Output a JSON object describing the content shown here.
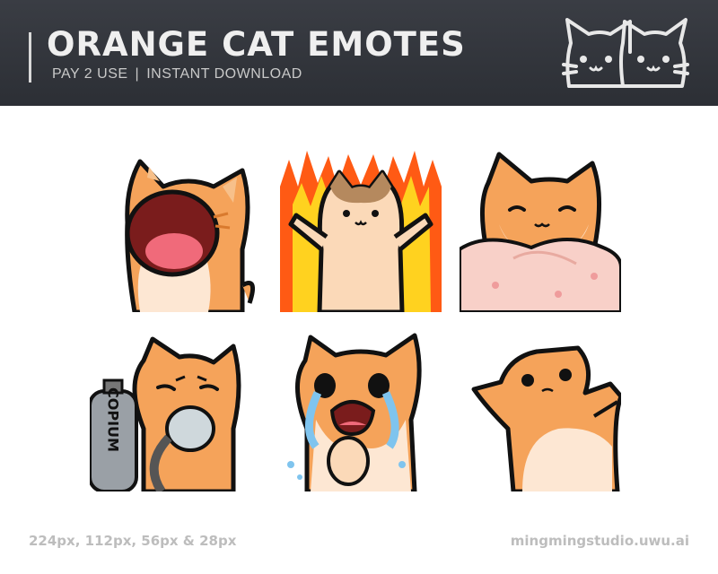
{
  "header": {
    "title": "ORANGE CAT EMOTES",
    "tagline_left": "PAY 2 USE",
    "tagline_sep": "|",
    "tagline_right": "INSTANT DOWNLOAD",
    "logo_icon": "two-cat-faces-logo"
  },
  "emotes": [
    {
      "name": "screaming-cat"
    },
    {
      "name": "fire-cat"
    },
    {
      "name": "blanket-cat"
    },
    {
      "name": "copium-cat",
      "tank_label": "COPIUM"
    },
    {
      "name": "crying-cat"
    },
    {
      "name": "lying-cat"
    }
  ],
  "footer": {
    "sizes": "224px, 112px, 56px & 28px",
    "website": "mingmingstudio.uwu.ai"
  },
  "colors": {
    "header_bg": "#2f3238",
    "cat_orange": "#f5a35a",
    "cat_cream": "#fde7d3",
    "outline": "#111111",
    "footer_text": "#bdbdbd"
  }
}
